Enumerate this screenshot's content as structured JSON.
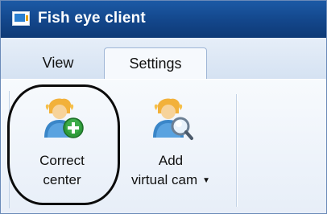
{
  "window": {
    "title": "Fish eye client"
  },
  "tabs": {
    "view_label": "View",
    "settings_label": "Settings"
  },
  "ribbon": {
    "correct_center": {
      "line1": "Correct",
      "line2": "center",
      "icon": "user-add-icon"
    },
    "add_virtual_cam": {
      "line1": "Add",
      "line2": "virtual cam",
      "icon": "user-search-icon",
      "dropdown_icon": "dropdown-arrow-icon"
    }
  },
  "annotation": {
    "type": "highlight-circle",
    "color": "#0b0b0b"
  }
}
